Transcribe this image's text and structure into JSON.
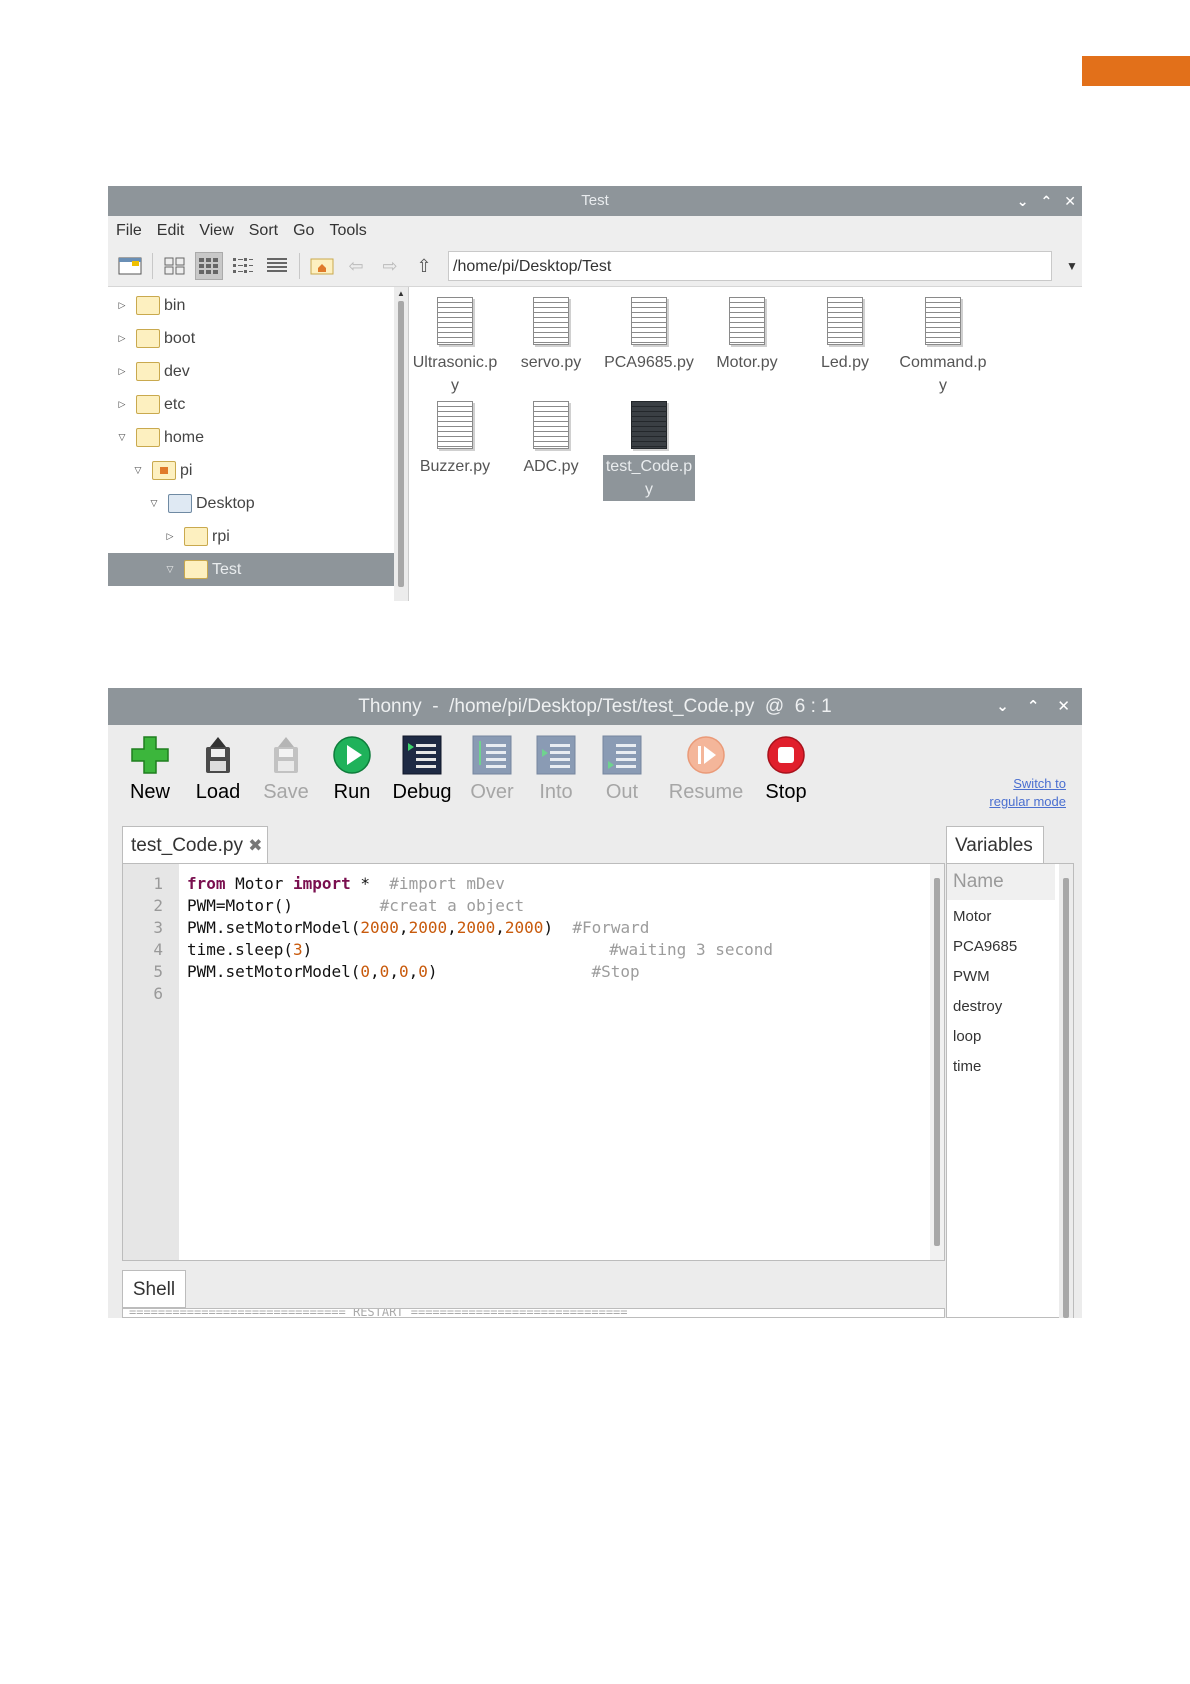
{
  "file_manager": {
    "title": "Test",
    "menu": [
      "File",
      "Edit",
      "View",
      "Sort",
      "Go",
      "Tools"
    ],
    "path": "/home/pi/Desktop/Test",
    "tree": [
      "bin",
      "boot",
      "dev",
      "etc",
      "home",
      "pi",
      "Desktop",
      "rpi",
      "Test"
    ],
    "files": [
      "Ultrasonic.p\ny",
      "servo.py",
      "PCA9685.py",
      "Motor.py",
      "Led.py",
      "Command.p\ny",
      "Buzzer.py",
      "ADC.py",
      "test_Code.p\ny"
    ]
  },
  "thonny": {
    "title": "Thonny  -  /home/pi/Desktop/Test/test_Code.py  @  6 : 1",
    "toolbar": {
      "new": "New",
      "load": "Load",
      "save": "Save",
      "run": "Run",
      "debug": "Debug",
      "over": "Over",
      "into": "Into",
      "out": "Out",
      "resume": "Resume",
      "stop": "Stop"
    },
    "switch_mode": [
      "Switch to",
      "regular mode"
    ],
    "editor_tab": "test_Code.py",
    "line_numbers": [
      "1",
      "2",
      "3",
      "4",
      "5",
      "6"
    ],
    "code": {
      "l1_kw1": "from",
      "l1_mod": " Motor ",
      "l1_kw2": "import",
      "l1_rest": " *  ",
      "l1_cm": "#import mDev",
      "l2_code": "PWM=Motor()         ",
      "l2_cm": "#creat a object",
      "l3_pre": "PWM.setMotorModel(",
      "l3_n1": "2000",
      "l3_n2": "2000",
      "l3_n3": "2000",
      "l3_n4": "2000",
      "l3_post": ")  ",
      "l3_cm": "#Forward",
      "l4_pre": "time.sleep(",
      "l4_n": "3",
      "l4_post": ")",
      "l4_cm": "#waiting 3 second",
      "l5_pre": "PWM.setMotorModel(",
      "l5_n1": "0",
      "l5_n2": "0",
      "l5_n3": "0",
      "l5_n4": "0",
      "l5_post": ")",
      "l5_cm": "#Stop",
      "comma": ","
    },
    "shell_tab": "Shell",
    "shell_line": "============================== RESTART ==============================",
    "variables": {
      "tab": "Variables",
      "header": "Name",
      "items": [
        "Motor",
        "PCA9685",
        "PWM",
        "destroy",
        "loop",
        "time"
      ]
    }
  }
}
